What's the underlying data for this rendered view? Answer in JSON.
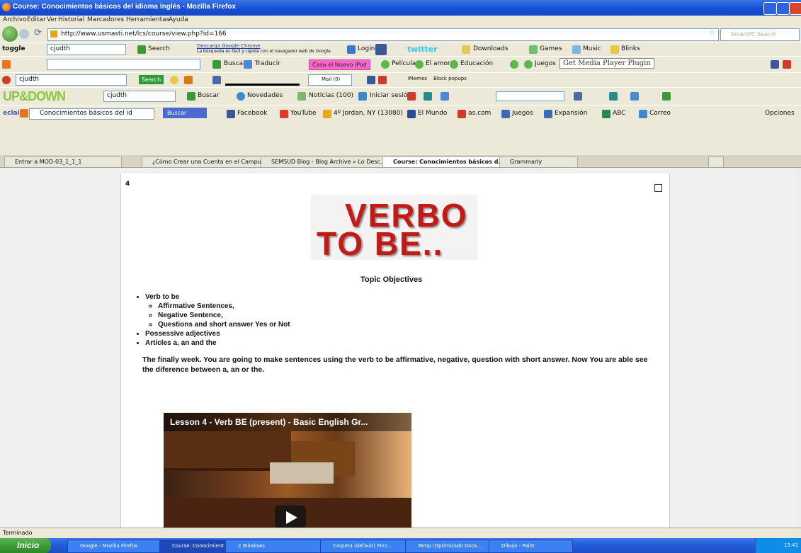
{
  "window": {
    "title": "Course: Conocimientos básicos del idioma Inglés - Mozilla Firefox"
  },
  "menubar": [
    "Archivo",
    "Editar",
    "Ver",
    "Historial",
    "Marcadores",
    "Herramientas",
    "Ayuda"
  ],
  "nav": {
    "url": "http://www.usmasti.net/lcs/course/view.php?id=166",
    "search_placeholder": "SmartPC Search"
  },
  "toolbar_toggle": {
    "name": "toggle",
    "input": "cjudth",
    "search_label": "Search",
    "ad_line1": "Descarga Google Chrome",
    "ad_line2": "La búsqueda es fácil y rápida con el navegador web de Google.",
    "login": "Login",
    "twitter": "twitter",
    "downloads": "Downloads",
    "games": "Games",
    "music": "Music",
    "blinks": "Blinks"
  },
  "toolbar_buscar": {
    "buscar": "Buscar",
    "traducir": "Traducir",
    "pink_button": "Casa el Nuevo iPod",
    "peliculas": "Películas",
    "el_amor": "El amor",
    "educacion": "Educación",
    "juegos": "Juegos",
    "media_flags": "Get Media Player Plugin"
  },
  "toolbar_sub": {
    "input": "cjudth",
    "search": "Search",
    "mail": "Mail (0)",
    "memes": "!Memes",
    "block_popups": "Block popups"
  },
  "toolbar_updown": {
    "logo": "UP&DOWN",
    "input": "cjudth",
    "buscar": "Buscar",
    "novedades": "Novedades",
    "noticias": "Noticias (100)",
    "iniciar_sesion": "Iniciar sesión"
  },
  "toolbar_bookmarks": {
    "search_value": "Conocimientos básicos del id",
    "buscar_btn": "Buscar",
    "items": [
      "Facebook",
      "YouTube",
      "4º Jordan, NY (13080)",
      "El Mundo",
      "as.com",
      "Juegos",
      "Expansión",
      "ABC",
      "Correo"
    ],
    "opciones": "Opciones"
  },
  "tabs": [
    {
      "label": "Entrar a MOD-03_1_1_1"
    },
    {
      "label": "¿Cómo Crear una Cuenta en el Campus..."
    },
    {
      "label": "SEMSUD Blog - Blog Archive » Lo Desc..."
    },
    {
      "label": "Course: Conocimientos básicos d...",
      "active": true
    },
    {
      "label": "Grammarly"
    }
  ],
  "content": {
    "section_number": "4",
    "logo_line1": "VERBO",
    "logo_line2": "TO BE..",
    "topic_heading": "Topic Objectives",
    "objectives": {
      "item1": "Verb to be",
      "sub1": "Affirmative Sentences,",
      "sub2": "Negative Sentence,",
      "sub3": "Questions and short answer Yes or Not",
      "item2": "Possessive adjectives",
      "item3": "Articles a, an and the"
    },
    "paragraph": "The finally week. You are going to make sentences using the verb to be affirmative, negative, question with short answer. Now You are able see the diference between a, an or the.",
    "video_title": "Lesson 4 - Verb BE (present) - Basic English Gr..."
  },
  "status": "Terminado",
  "taskbar": {
    "start": "Inicio",
    "items": [
      "Google - Mozilla Firefox",
      "Course: Conocimient...",
      "2 Windows",
      "Carpeta (default) Micr...",
      "Temp (Optimizado Dock...",
      "Dibujo - Paint"
    ],
    "clock": "15:41"
  },
  "colors": {
    "titlebar": "#1650d8",
    "taskbar": "#245edb",
    "start": "#3a9b32",
    "logo_red": "#c41a16",
    "pink": "#ff66cc"
  }
}
